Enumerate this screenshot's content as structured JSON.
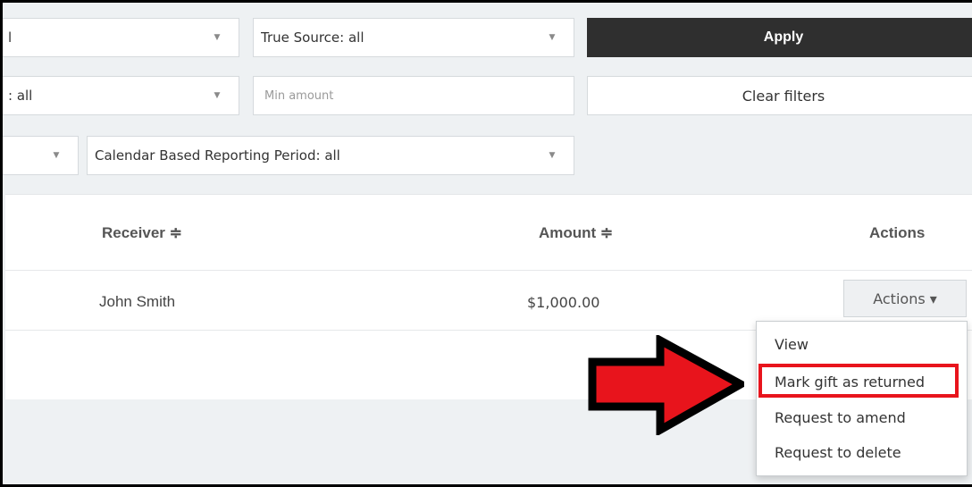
{
  "filters": {
    "row1_select_left": {
      "value": "l"
    },
    "true_source": {
      "value": "True Source: all"
    },
    "row2_select_left": {
      "value": ": all"
    },
    "min_amount": {
      "placeholder": "Min amount"
    },
    "row3_select_left": {
      "value": ""
    },
    "reporting_period": {
      "value": "Calendar Based Reporting Period: all"
    },
    "apply_label": "Apply",
    "clear_label": "Clear filters"
  },
  "table": {
    "columns": {
      "receiver": "Receiver ≑",
      "amount": "Amount ≑",
      "actions": "Actions"
    },
    "rows": [
      {
        "receiver": "John Smith",
        "amount": "$1,000.00",
        "actions_label": "Actions ▾"
      }
    ]
  },
  "actions_menu": {
    "items": [
      "View",
      "Mark gift as returned",
      "Request to amend",
      "Request to delete"
    ],
    "highlighted_index": 1
  },
  "colors": {
    "arrow": "#e8141c",
    "highlight": "#e8141c",
    "apply_bg": "#2f2f2f"
  },
  "icons": {
    "caret": "caret-down-icon",
    "arrow": "red-arrow-annotation"
  }
}
